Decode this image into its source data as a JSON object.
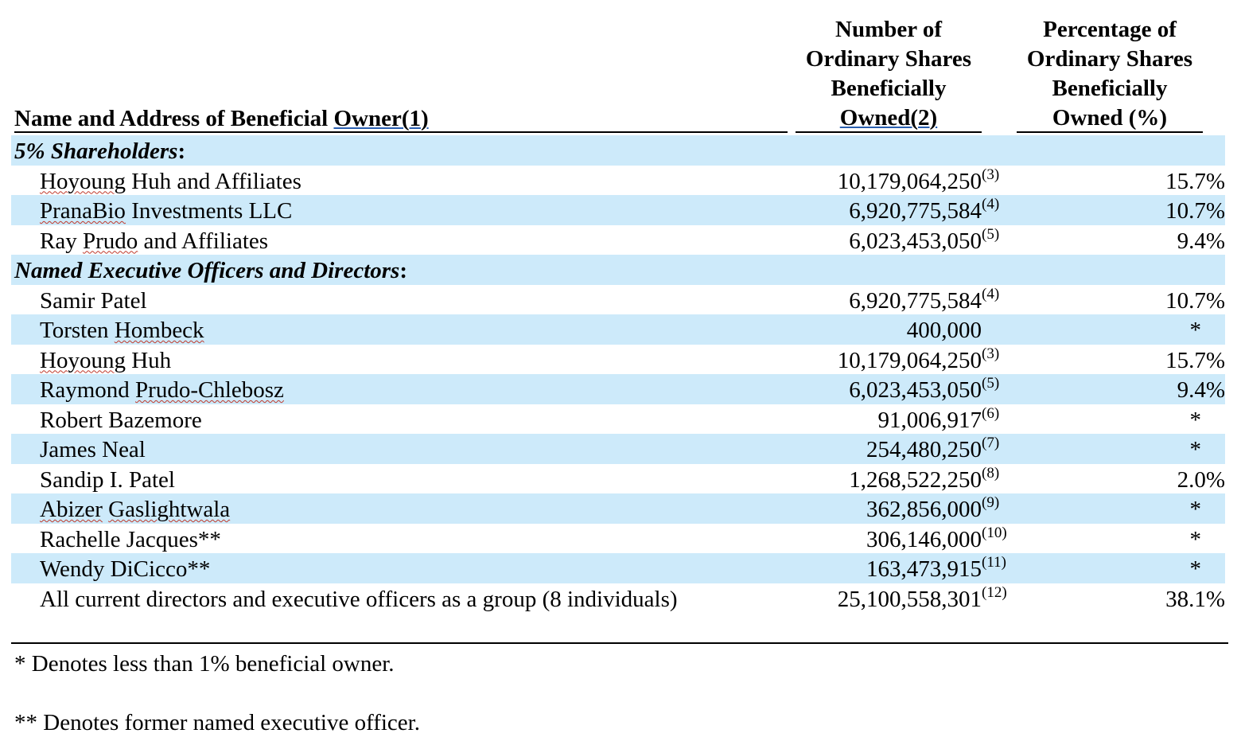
{
  "header": {
    "name_col": {
      "text": "Name and Address of Beneficial ",
      "underlined": "Owner(1)"
    },
    "shares_col": {
      "lines": [
        "Number of",
        "Ordinary Shares",
        "Beneficially"
      ],
      "last": "Owned(2)"
    },
    "pct_col": {
      "lines": [
        "Percentage of",
        "Ordinary Shares",
        "Beneficially",
        "Owned (%)"
      ]
    }
  },
  "rows": [
    {
      "type": "section",
      "label": "5% Shareholders",
      "suffix": ":",
      "shaded": true
    },
    {
      "type": "person",
      "name_parts": [
        {
          "t": "Hoyoung",
          "sq": true
        },
        {
          "t": " Huh and Affiliates"
        }
      ],
      "shares": "10,179,064,250",
      "footnote": "(3)",
      "pct": "15.7%",
      "shaded": false
    },
    {
      "type": "person",
      "name_parts": [
        {
          "t": "PranaBio",
          "sq": true
        },
        {
          "t": " Investments LLC"
        }
      ],
      "shares": "6,920,775,584",
      "footnote": "(4)",
      "pct": "10.7%",
      "shaded": true
    },
    {
      "type": "person",
      "name_parts": [
        {
          "t": "Ray "
        },
        {
          "t": "Prudo",
          "sq": true
        },
        {
          "t": " and Affiliates"
        }
      ],
      "shares": "6,023,453,050",
      "footnote": "(5)",
      "pct": "9.4%",
      "shaded": false
    },
    {
      "type": "section",
      "label": "Named Executive Officers and Directors",
      "suffix": ":",
      "shaded": true
    },
    {
      "type": "person",
      "name_parts": [
        {
          "t": "Samir Patel"
        }
      ],
      "shares": "6,920,775,584",
      "footnote": "(4)",
      "pct": "10.7%",
      "shaded": false
    },
    {
      "type": "person",
      "name_parts": [
        {
          "t": "Torsten "
        },
        {
          "t": "Hombeck",
          "sq": true
        }
      ],
      "shares": "400,000",
      "footnote": "",
      "pct": "*",
      "shaded": true
    },
    {
      "type": "person",
      "name_parts": [
        {
          "t": "Hoyoung",
          "sq": true
        },
        {
          "t": " Huh"
        }
      ],
      "shares": "10,179,064,250",
      "footnote": "(3)",
      "pct": "15.7%",
      "shaded": false
    },
    {
      "type": "person",
      "name_parts": [
        {
          "t": "Raymond "
        },
        {
          "t": "Prudo-Chlebosz",
          "sq": true
        }
      ],
      "shares": "6,023,453,050",
      "footnote": "(5)",
      "pct": "9.4%",
      "shaded": true
    },
    {
      "type": "person",
      "name_parts": [
        {
          "t": "Robert Bazemore"
        }
      ],
      "shares": "91,006,917",
      "footnote": "(6)",
      "pct": "*",
      "shaded": false
    },
    {
      "type": "person",
      "name_parts": [
        {
          "t": "James Neal"
        }
      ],
      "shares": "254,480,250",
      "footnote": "(7)",
      "pct": "*",
      "shaded": true
    },
    {
      "type": "person",
      "name_parts": [
        {
          "t": "Sandip I. Patel"
        }
      ],
      "shares": "1,268,522,250",
      "footnote": "(8)",
      "pct": "2.0%",
      "shaded": false
    },
    {
      "type": "person",
      "name_parts": [
        {
          "t": "Abizer",
          "sq": true
        },
        {
          "t": " "
        },
        {
          "t": "Gaslightwala",
          "sq": true
        }
      ],
      "shares": "362,856,000",
      "footnote": "(9)",
      "pct": "*",
      "shaded": true
    },
    {
      "type": "person",
      "name_parts": [
        {
          "t": "Rachelle Jacques**"
        }
      ],
      "shares": "306,146,000",
      "footnote": "(10)",
      "pct": "*",
      "shaded": false
    },
    {
      "type": "person",
      "name_parts": [
        {
          "t": "Wendy DiCicco**"
        }
      ],
      "shares": "163,473,915",
      "footnote": "(11)",
      "pct": "*",
      "shaded": true
    },
    {
      "type": "person",
      "name_parts": [
        {
          "t": "All current directors and executive officers as a group (8 individuals)"
        }
      ],
      "shares": "25,100,558,301",
      "footnote": "(12)",
      "pct": "38.1%",
      "shaded": false
    }
  ],
  "footnotes": {
    "single_star": "* Denotes less than 1% beneficial owner.",
    "double_star": "** Denotes former named executive officer."
  },
  "colors": {
    "row_shade": "#cdeafa",
    "spell_squiggle": "#c0392b",
    "link_underline": "#2a5fb0"
  }
}
